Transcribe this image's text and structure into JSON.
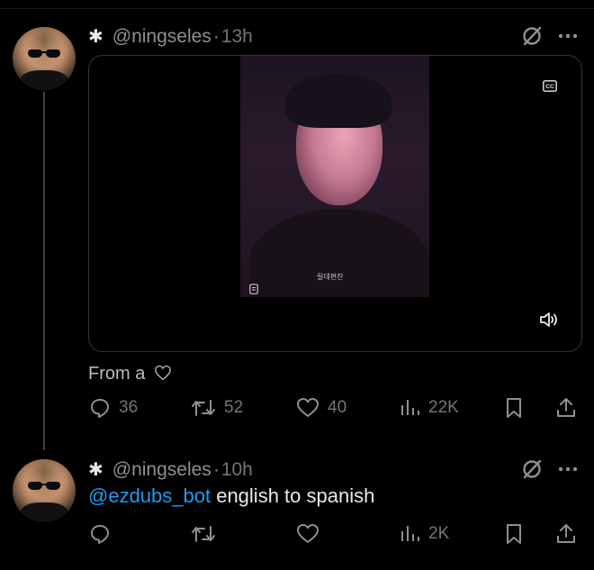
{
  "tweets": [
    {
      "handle": "@ningseles",
      "separator": "·",
      "time": "13h",
      "caption": "From a",
      "stats": {
        "replies": "36",
        "reposts": "52",
        "likes": "40",
        "views": "22K"
      },
      "media_watermark": "릴데편찬"
    },
    {
      "handle": "@ningseles",
      "separator": "·",
      "time": "10h",
      "mention": "@ezdubs_bot",
      "text": " english to spanish",
      "stats": {
        "views": "2K"
      }
    }
  ],
  "icons": [
    "asterisk-icon",
    "grok-icon",
    "more-icon",
    "cc-icon",
    "volume-icon",
    "reply-icon",
    "repost-icon",
    "like-icon",
    "views-icon",
    "bookmark-icon",
    "share-icon",
    "heart-outline-icon",
    "document-icon"
  ],
  "colors": {
    "background": "#000000",
    "text": "#e7e9ea",
    "muted": "#71767b",
    "link": "#1d9bf0"
  }
}
